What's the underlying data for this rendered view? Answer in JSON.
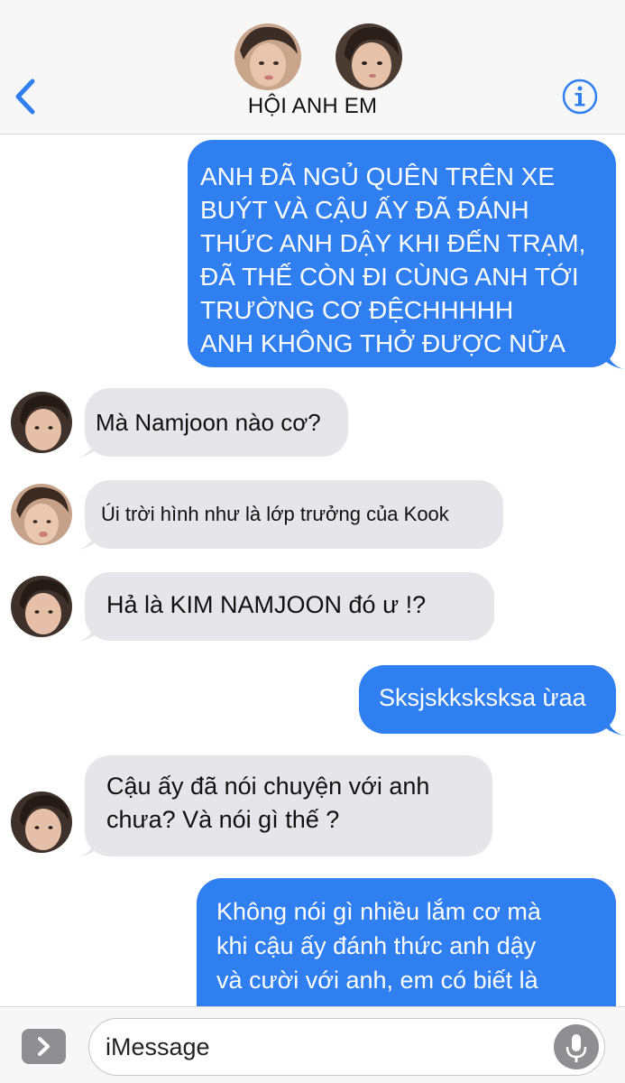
{
  "header": {
    "title": "HỘI ANH EM",
    "accent_color": "#2f7ff1",
    "back_icon": "chevron-left-icon",
    "info_icon": "info-icon"
  },
  "messages": [
    {
      "direction": "outgoing",
      "text": "ANH ĐÃ NGỦ QUÊN TRÊN XE\nBUÝT VÀ CẬU ẤY ĐÃ ĐÁNH\nTHỨC ANH DẬY KHI ĐẾN TRẠM,\nĐÃ THẾ CÒN ĐI CÙNG ANH TỚI\nTRƯỜNG CƠ ĐỆCHHHHH\nANH KHÔNG THỞ ĐƯỢC NỮA"
    },
    {
      "direction": "incoming",
      "text": "Mà Namjoon nào cơ?"
    },
    {
      "direction": "incoming",
      "text": "Úi trời hình như là lớp trưởng của Kook"
    },
    {
      "direction": "incoming",
      "text": "Hả là KIM NAMJOON đó ư !?"
    },
    {
      "direction": "outgoing",
      "text": "Sksjskksksksa ừaa"
    },
    {
      "direction": "incoming",
      "text": "Cậu ấy đã nói chuyện với anh\nchưa? Và nói gì thế ?"
    },
    {
      "direction": "outgoing",
      "text": "Không nói gì nhiều lắm cơ mà\nkhi cậu ấy đánh thức anh dậy\nvà cười với anh, em có biết là"
    }
  ],
  "input": {
    "placeholder": "iMessage",
    "app_icon": "chevron-right-icon",
    "mic_icon": "microphone-icon"
  },
  "colors": {
    "outgoing_bubble": "#2f7ff1",
    "incoming_bubble": "#e6e5ea",
    "header_bg": "#f7f7f7"
  }
}
